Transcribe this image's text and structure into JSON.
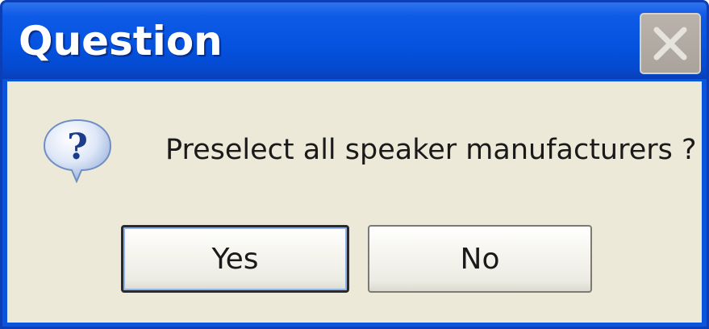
{
  "window": {
    "title": "Question",
    "close_icon": "close-icon"
  },
  "dialog": {
    "icon": "question-icon",
    "message": "Preselect all speaker manufacturers ?"
  },
  "buttons": {
    "yes_label": "Yes",
    "no_label": "No"
  },
  "colors": {
    "titlebar": "#0553e0",
    "client_background": "#ece9d8",
    "close_button": "#b2aca4",
    "focus_ring": "#8fb3ea"
  }
}
